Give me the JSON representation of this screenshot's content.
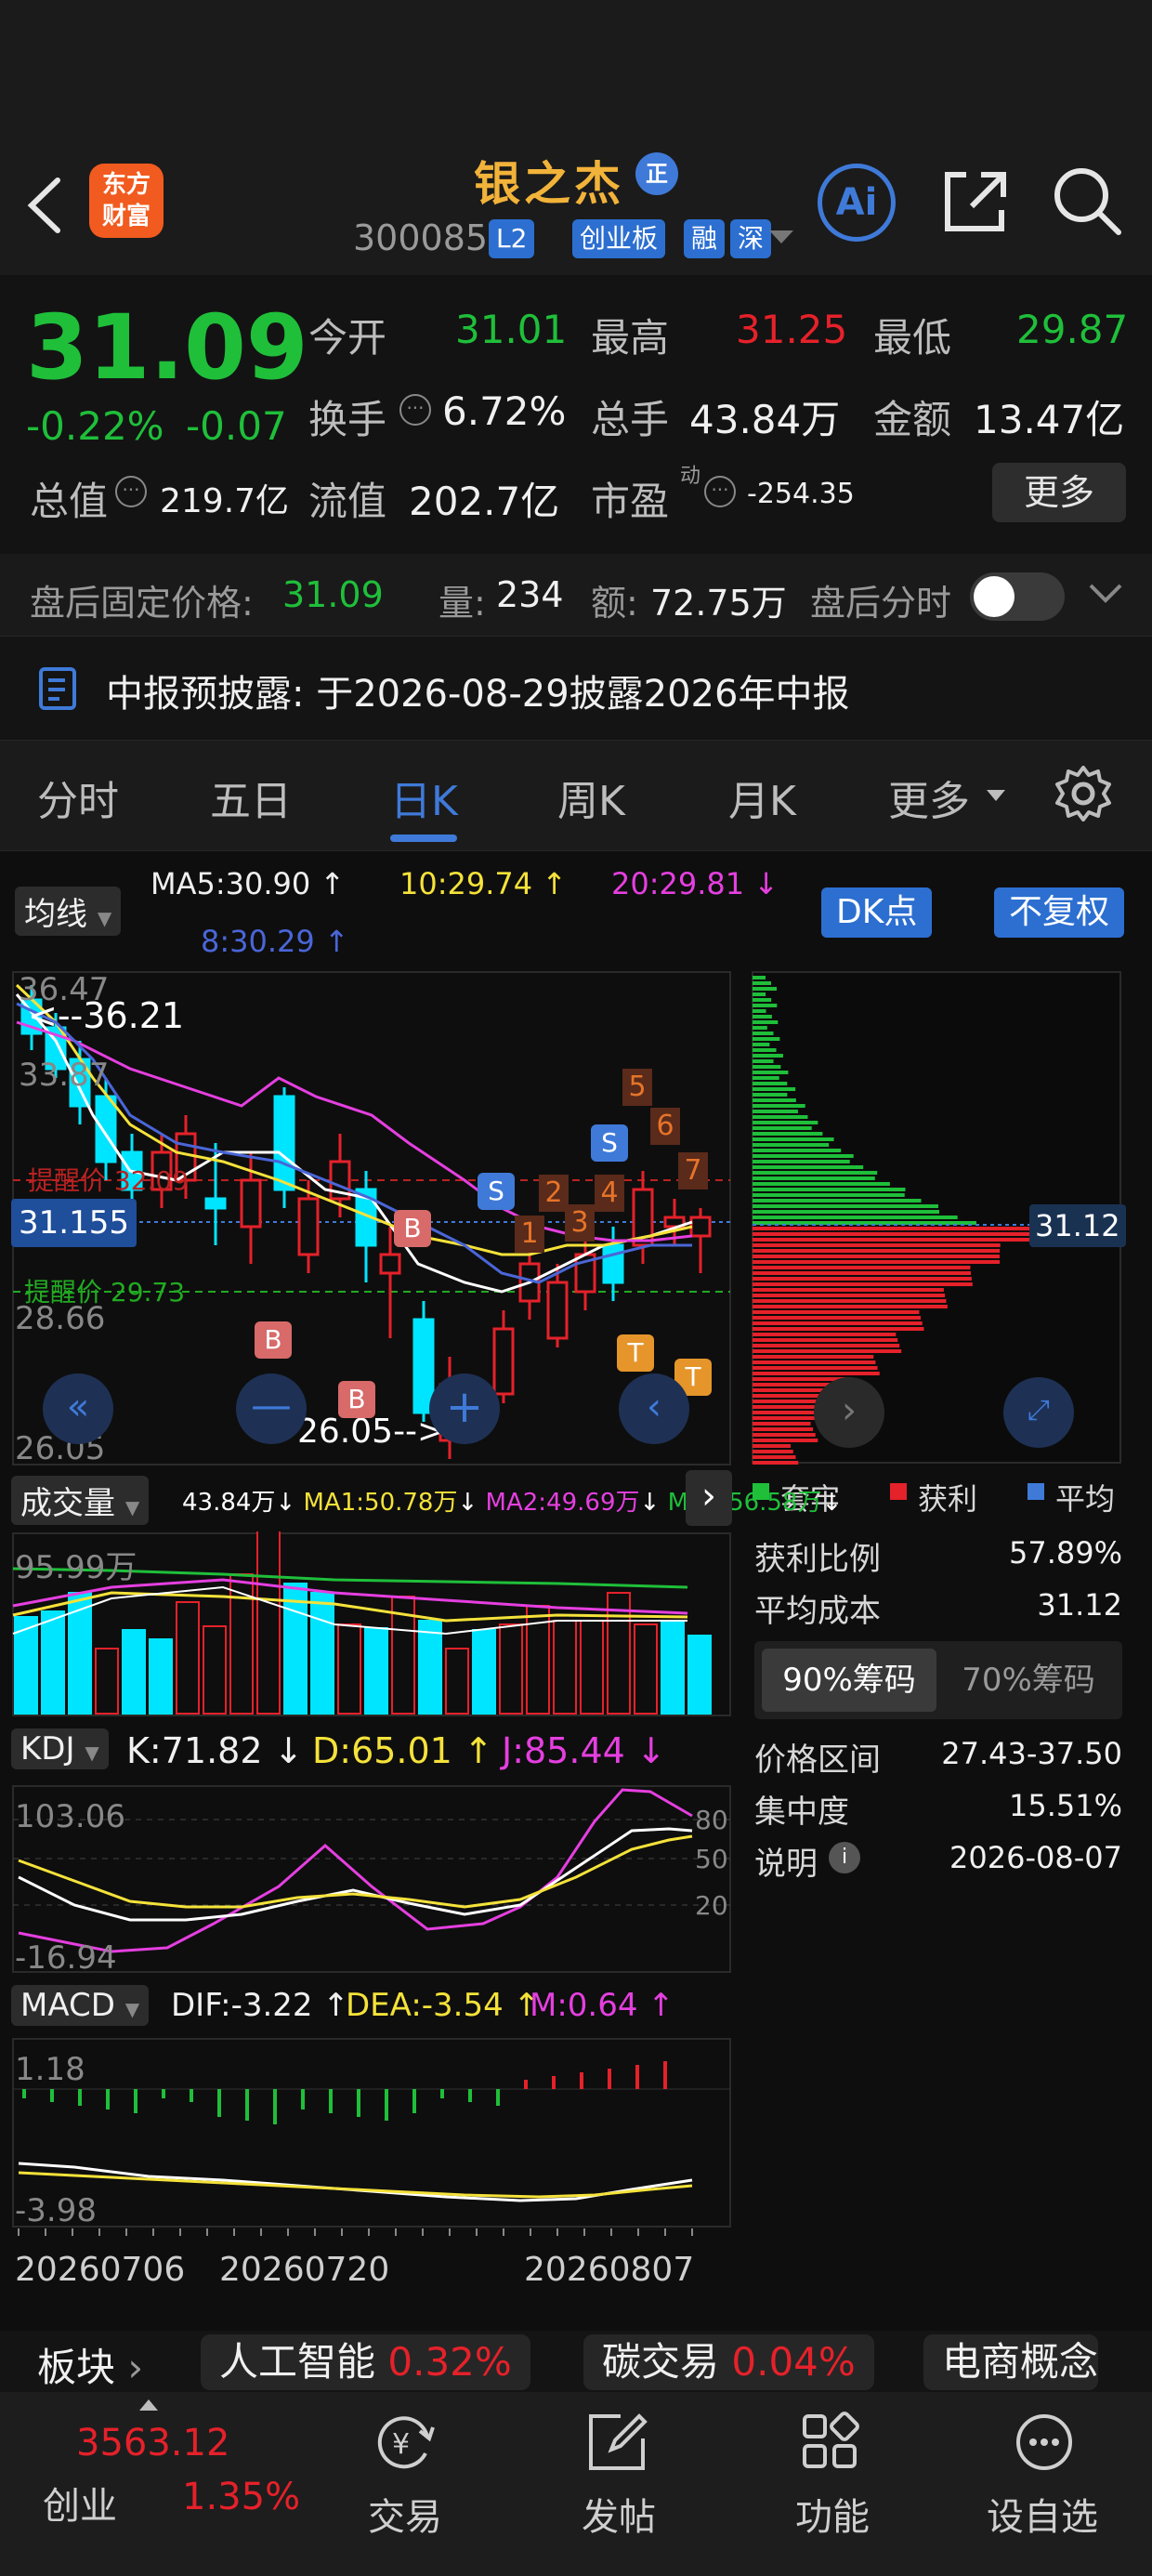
{
  "header": {
    "logo_text_1": "东方",
    "logo_text_2": "财富",
    "stock_name": "银之杰",
    "name_badge": "正",
    "code": "300085",
    "tags": [
      "L2",
      "创业板",
      "融",
      "深"
    ],
    "ai_label": "Ai"
  },
  "quote": {
    "price": "31.09",
    "change_pct": "-0.22%",
    "change": "-0.07",
    "open_label": "今开",
    "open": "31.01",
    "high_label": "最高",
    "high": "31.25",
    "low_label": "最低",
    "low": "29.87",
    "turnover_label": "换手",
    "turnover": "6.72%",
    "volume_label": "总手",
    "volume": "43.84万",
    "amount_label": "金额",
    "amount": "13.47亿",
    "mktcap_label": "总值",
    "mktcap": "219.7亿",
    "float_label": "流值",
    "float": "202.7亿",
    "pe_label": "市盈",
    "pe_sup": "动",
    "pe": "-254.35",
    "more_label": "更多"
  },
  "after_hours": {
    "price_label": "盘后固定价格:",
    "price": "31.09",
    "vol_label": "量:",
    "vol": "234",
    "amt_label": "额:",
    "amt": "72.75万",
    "timeline_label": "盘后分时"
  },
  "notice": {
    "text": "中报预披露:  于2026-08-29披露2026年中报"
  },
  "tabs": [
    "分时",
    "五日",
    "日K",
    "周K",
    "月K",
    "更多"
  ],
  "active_tab": 2,
  "kline": {
    "ma_toggle": "均线",
    "ma5": "MA5:30.90",
    "ma10": "10:29.74",
    "ma20": "20:29.81",
    "ma8": "8:30.29",
    "dk_btn": "DK点",
    "adj_btn": "不复权",
    "y_top": "36.47",
    "y_2": "33.87",
    "y_3": "28.66",
    "y_bottom": "26.05",
    "hi_marker": "36.21",
    "lo_marker": "26.05",
    "price_tag": "31.155",
    "alert_high": "提醒价 32.09",
    "alert_low": "提醒价 29.73",
    "signals": [
      "S",
      "S",
      "B",
      "B",
      "B"
    ],
    "dk_nums": [
      "1",
      "2",
      "3",
      "4",
      "5",
      "6",
      "7"
    ],
    "t_marks": [
      "T",
      "T"
    ]
  },
  "chip": {
    "price_tag": "31.12",
    "legend": [
      "套牢",
      "获利",
      "平均"
    ],
    "profit_ratio_label": "获利比例",
    "profit_ratio": "57.89%",
    "avg_cost_label": "平均成本",
    "avg_cost": "31.12",
    "tab_90": "90%筹码",
    "tab_70": "70%筹码",
    "range_label": "价格区间",
    "range": "27.43-37.50",
    "conc_label": "集中度",
    "conc": "15.51%",
    "note_label": "说明",
    "note_date": "2026-08-07"
  },
  "volume": {
    "label": "成交量",
    "cur": "43.84万",
    "ma1": "MA1:50.78万",
    "ma2": "MA2:49.69万",
    "ma3": "MA3:56.58万",
    "y_top": "95.99万"
  },
  "kdj": {
    "label": "KDJ",
    "k": "K:71.82",
    "d": "D:65.01",
    "j": "J:85.44",
    "y_top": "103.06",
    "y_bottom": "-16.94",
    "lv80": "80",
    "lv50": "50",
    "lv20": "20"
  },
  "macd": {
    "label": "MACD",
    "dif": "DIF:-3.22",
    "dea": "DEA:-3.54",
    "m": "M:0.64",
    "y_top": "1.18",
    "y_bottom": "-3.98"
  },
  "dates": [
    "20260706",
    "20260720",
    "20260807"
  ],
  "sectors": {
    "label": "板块",
    "items": [
      {
        "name": "人工智能",
        "pct": "0.32%"
      },
      {
        "name": "碳交易",
        "pct": "0.04%"
      },
      {
        "name": "电商概念",
        "pct": ""
      }
    ]
  },
  "bottom_nav": {
    "index_value": "3563.12",
    "index_name": "创业",
    "index_pct": "1.35%",
    "items": [
      "交易",
      "发帖",
      "功能",
      "设自选"
    ]
  }
}
